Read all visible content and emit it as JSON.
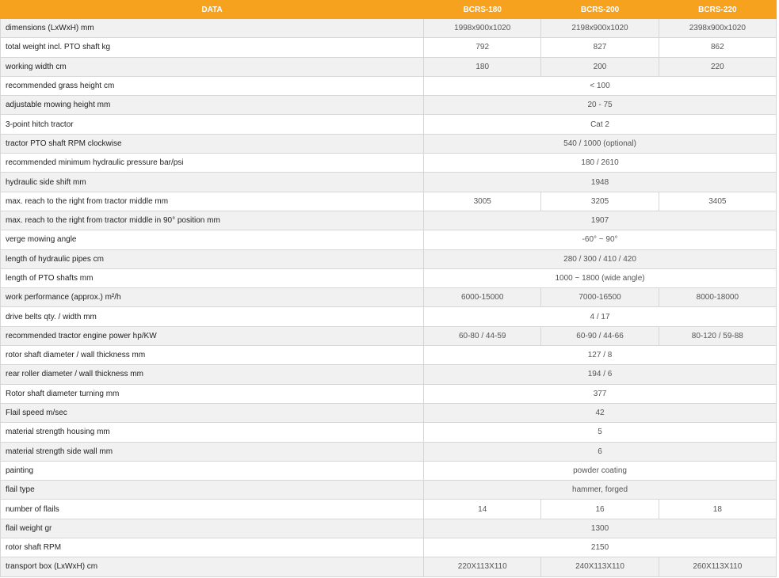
{
  "header": {
    "data": "DATA",
    "models": [
      "BCRS-180",
      "BCRS-200",
      "BCRS-220"
    ]
  },
  "rows": [
    {
      "label": "dimensions (LxWxH)  mm",
      "values": [
        "1998x900x1020",
        "2198x900x1020",
        "2398x900x1020"
      ]
    },
    {
      "label": "total weight incl. PTO shaft  kg",
      "values": [
        "792",
        "827",
        "862"
      ]
    },
    {
      "label": "working width  cm",
      "values": [
        "180",
        "200",
        "220"
      ]
    },
    {
      "label": "recommended grass height  cm",
      "values": [
        "< 100"
      ]
    },
    {
      "label": "adjustable mowing height   mm",
      "values": [
        "20 - 75"
      ]
    },
    {
      "label": "3-point hitch tractor",
      "values": [
        "Cat 2"
      ]
    },
    {
      "label": "tractor PTO shaft RPM clockwise",
      "values": [
        "540 / 1000 (optional)"
      ]
    },
    {
      "label": "recommended minimum hydraulic pressure  bar/psi",
      "values": [
        "180 / 2610"
      ]
    },
    {
      "label": "hydraulic side shift  mm",
      "values": [
        "1948"
      ]
    },
    {
      "label": "max. reach to the right from tractor middle  mm",
      "values": [
        "3005",
        "3205",
        "3405"
      ]
    },
    {
      "label": "max. reach to the right from tractor middle in 90° position  mm",
      "values": [
        "1907"
      ]
    },
    {
      "label": "verge mowing angle",
      "values": [
        "-60° ~ 90°"
      ]
    },
    {
      "label": "length of hydraulic pipes  cm",
      "values": [
        "280 / 300 / 410 / 420"
      ]
    },
    {
      "label": "length of PTO shafts  mm",
      "values": [
        "1000 ~ 1800 (wide angle)"
      ]
    },
    {
      "label": "work performance (approx.)  m²/h",
      "values": [
        "6000-15000",
        "7000-16500",
        "8000-18000"
      ]
    },
    {
      "label": "drive belts    qty.  / width  mm",
      "values": [
        "4 / 17"
      ]
    },
    {
      "label": "recommended tractor engine power  hp/KW",
      "values": [
        "60-80 / 44-59",
        "60-90 / 44-66",
        "80-120 / 59-88"
      ]
    },
    {
      "label": "rotor shaft  diameter / wall thickness  mm",
      "values": [
        "127 / 8"
      ]
    },
    {
      "label": "rear roller  diameter / wall thickness  mm",
      "values": [
        "194 / 6"
      ]
    },
    {
      "label": "Rotor shaft diameter turning mm",
      "values": [
        "377"
      ]
    },
    {
      "label": "Flail speed m/sec",
      "values": [
        "42"
      ]
    },
    {
      "label": "material strength  housing  mm",
      "values": [
        "5"
      ]
    },
    {
      "label": "material strength side wall  mm",
      "values": [
        "6"
      ]
    },
    {
      "label": "painting",
      "values": [
        "powder coating"
      ]
    },
    {
      "label": "flail type",
      "values": [
        "hammer, forged"
      ]
    },
    {
      "label": "number of flails",
      "values": [
        "14",
        "16",
        "18"
      ]
    },
    {
      "label": "flail weight  gr",
      "values": [
        "1300"
      ]
    },
    {
      "label": "rotor shaft  RPM",
      "values": [
        "2150"
      ]
    },
    {
      "label": "transport box (LxWxH) cm",
      "values": [
        "220X113X110",
        "240X113X110",
        "260X113X110"
      ]
    }
  ]
}
